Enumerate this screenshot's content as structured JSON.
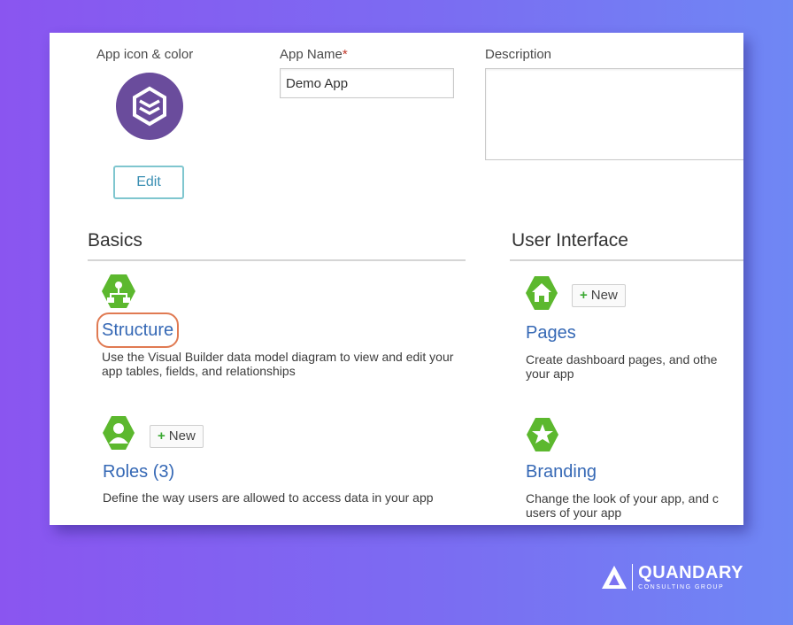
{
  "form": {
    "app_icon_label": "App icon & color",
    "app_name_label": "App Name",
    "app_name_required": "*",
    "app_name_value": "Demo App",
    "description_label": "Description",
    "description_value": "",
    "edit_label": "Edit"
  },
  "basics": {
    "title": "Basics",
    "structure": {
      "label": "Structure",
      "description": "Use the Visual Builder data model diagram to view and edit your app tables, fields, and relationships"
    },
    "roles": {
      "label": "Roles (3)",
      "new_label": "New",
      "description": "Define the way users are allowed to access data in your app"
    }
  },
  "user_interface": {
    "title": "User Interface",
    "pages": {
      "label": "Pages",
      "new_label": "New",
      "description": "Create dashboard pages, and othe your app"
    },
    "branding": {
      "label": "Branding",
      "description": "Change the look of your app, and c users of your app"
    }
  },
  "brand": {
    "name": "QUANDARY",
    "tagline": "CONSULTING GROUP"
  },
  "colors": {
    "icon_green": "#5cb82e",
    "app_icon_purple": "#6a4c9c",
    "link_blue": "#3568b5",
    "highlight_orange": "#e07a52"
  },
  "icons": [
    "app-cube-icon",
    "structure-icon",
    "roles-user-icon",
    "pages-home-icon",
    "branding-star-icon",
    "plus-icon",
    "quandary-logo-icon"
  ]
}
